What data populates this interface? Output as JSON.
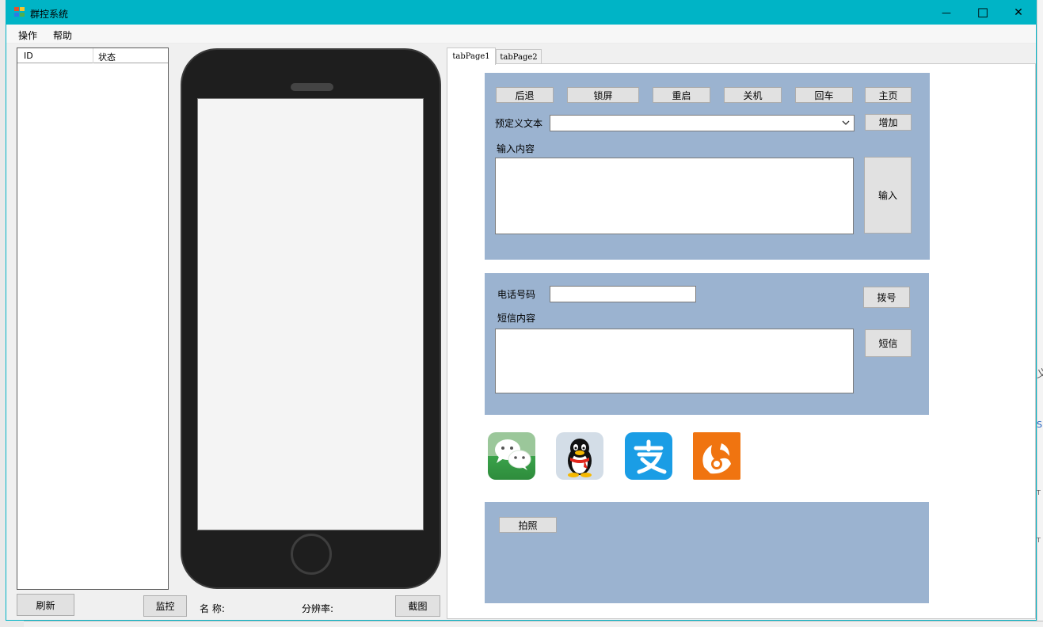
{
  "window": {
    "title": "群控系统",
    "minimize_glyph": "—",
    "maximize_glyph": "☐",
    "close_glyph": "✕"
  },
  "menu": {
    "items": [
      "操作",
      "帮助"
    ]
  },
  "device_list": {
    "columns": [
      "ID",
      "状态"
    ],
    "refresh_label": "刷新",
    "monitor_label": "监控"
  },
  "phone_info": {
    "name_label": "名  称:",
    "resolution_label": "分辨率:",
    "screenshot_label": "截图"
  },
  "tabs": [
    "tabPage1",
    "tabPage2"
  ],
  "controls": {
    "buttons": [
      "后退",
      "锁屏",
      "重启",
      "关机",
      "回车",
      "主页"
    ],
    "predefined_label": "预定义文本",
    "predefined_value": "",
    "add_label": "增加",
    "input_content_label": "输入内容",
    "input_content_value": "",
    "input_button_label": "输入"
  },
  "phone_section": {
    "phone_number_label": "电话号码",
    "phone_number_value": "",
    "dial_label": "拨号",
    "sms_content_label": "短信内容",
    "sms_content_value": "",
    "sms_label": "短信"
  },
  "apps": [
    {
      "name": "wechat-icon",
      "color": "#3aa24a"
    },
    {
      "name": "qq-icon",
      "color": "#d3dde7"
    },
    {
      "name": "alipay-icon",
      "color": "#1a9de5"
    },
    {
      "name": "uc-browser-icon",
      "color": "#f07410"
    }
  ],
  "camera": {
    "photo_label": "拍照"
  },
  "colors": {
    "titlebar": "#00b4c6",
    "group_panel": "#9bb3d0",
    "phone_body": "#1e1e1e"
  },
  "desktop": {
    "edge_glyphs": [
      "义",
      "S",
      "T",
      "T"
    ]
  }
}
